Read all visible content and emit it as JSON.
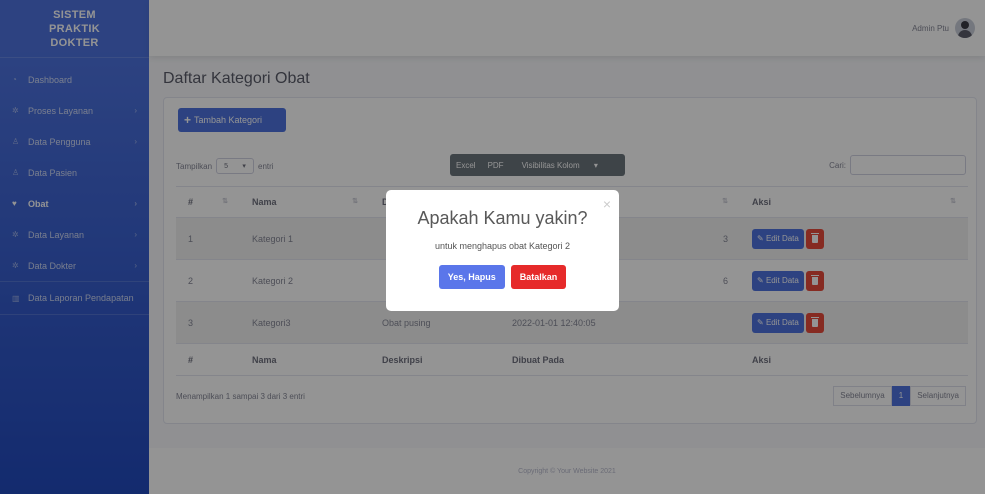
{
  "sidebar": {
    "brand": "SISTEM PRAKTIK DOKTER",
    "items": [
      {
        "label": "Dashboard",
        "icon": "gauge-icon"
      },
      {
        "label": "Proses Layanan",
        "icon": "gear-icon"
      },
      {
        "label": "Data Pengguna",
        "icon": "user-icon"
      },
      {
        "label": "Data Pasien",
        "icon": "user-icon"
      },
      {
        "label": "Obat",
        "icon": "heart-icon"
      },
      {
        "label": "Data Layanan",
        "icon": "gear-icon"
      },
      {
        "label": "Data Dokter",
        "icon": "gear-icon"
      },
      {
        "label": "Data Laporan Pendapatan",
        "icon": "chart-icon"
      }
    ]
  },
  "topbar": {
    "user_name": "Admin Ptu"
  },
  "page_title": "Daftar Kategori Obat",
  "toolbar": {
    "add_label": "Tambah Kategori"
  },
  "table_controls": {
    "show_label": "Tampilkan",
    "show_value": "5",
    "entries_label": "entri",
    "export_buttons": [
      "Excel",
      "PDF",
      "Visibilitas Kolom"
    ],
    "search_label": "Cari:"
  },
  "table": {
    "columns": [
      "#",
      "Nama",
      "Deskripsi",
      "Dibuat Pada",
      "Aksi"
    ],
    "rows": [
      {
        "no": "1",
        "nama": "Kategori 1",
        "deskripsi": "",
        "dibuat": "3"
      },
      {
        "no": "2",
        "nama": "Kategori 2",
        "deskripsi": "",
        "dibuat": "6"
      },
      {
        "no": "3",
        "nama": "Kategori3",
        "deskripsi": "Obat pusing",
        "dibuat": "2022-01-01 12:40:05"
      }
    ],
    "edit_label": "Edit Data"
  },
  "pagination": {
    "info": "Menampilkan 1 sampai 3 dari 3 entri",
    "prev": "Sebelumnya",
    "current": "1",
    "next": "Selanjutnya"
  },
  "footer": "Copyright © Your Website 2021",
  "modal": {
    "title": "Apakah Kamu yakin?",
    "text": "untuk menghapus obat Kategori 2",
    "confirm_label": "Yes, Hapus",
    "cancel_label": "Batalkan"
  },
  "colors": {
    "primary": "#4e73df",
    "danger": "#e74a3b",
    "confirm": "#5a76ea",
    "cancel": "#e62a2a"
  }
}
